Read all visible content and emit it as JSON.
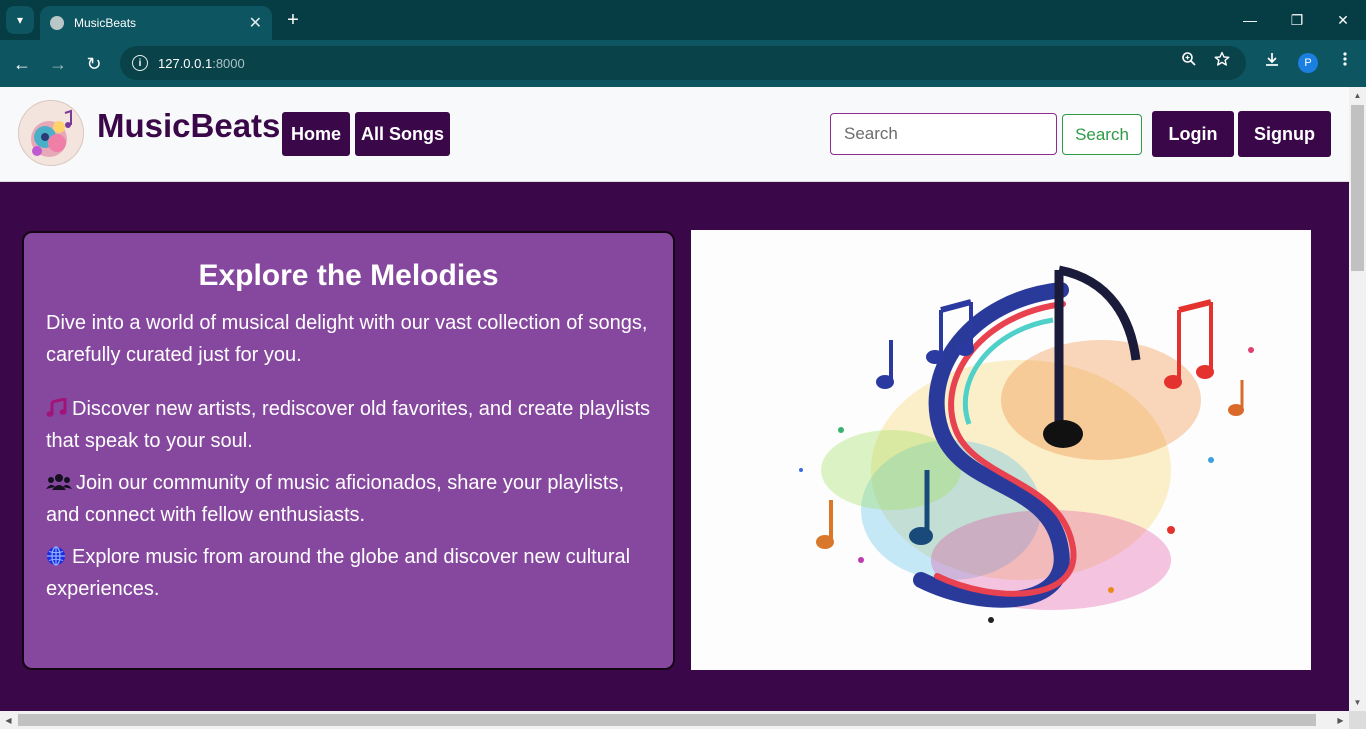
{
  "browser": {
    "tab_title": "MusicBeats",
    "url_host": "127.0.0.1",
    "url_port": ":8000",
    "profile_initial": "P",
    "tab_close": "✕",
    "new_tab": "+",
    "window_controls": {
      "minimize": "—",
      "maximize": "❐",
      "close": "✕"
    },
    "nav": {
      "back": "←",
      "forward": "→",
      "reload": "↻"
    },
    "icons": [
      "dropdown-icon",
      "zoom-icon",
      "star-icon",
      "download-icon",
      "menu-icon"
    ]
  },
  "header": {
    "brand": "MusicBeats",
    "nav": [
      {
        "label": "Home"
      },
      {
        "label": "All Songs"
      }
    ],
    "search": {
      "placeholder": "Search",
      "button": "Search"
    },
    "login": "Login",
    "signup": "Signup",
    "colors": {
      "primary": "#3a0848",
      "search_accent": "#2e9b47"
    }
  },
  "hero": {
    "title": "Explore the Melodies",
    "intro": "Dive into a world of musical delight with our vast collection of songs, carefully curated just for you.",
    "items": [
      {
        "icon": "music-note-icon",
        "text": "Discover new artists, rediscover old favorites, and create playlists that speak to your soul."
      },
      {
        "icon": "users-icon",
        "text": "Join our community of music aficionados, share your playlists, and connect with fellow enthusiasts."
      },
      {
        "icon": "globe-icon",
        "text": "Explore music from around the globe and discover new cultural experiences."
      }
    ],
    "card_color": "#86489e"
  }
}
